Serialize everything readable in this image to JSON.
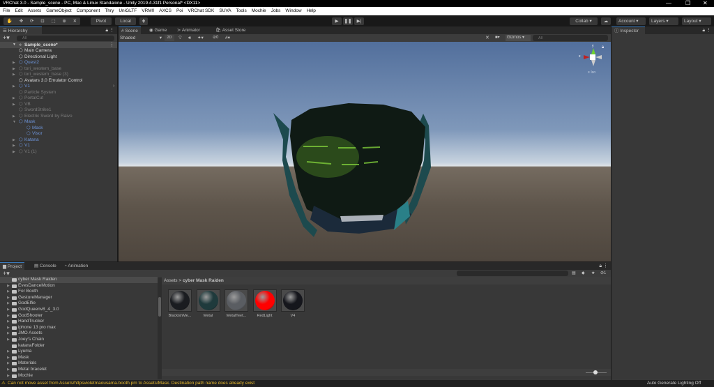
{
  "window": {
    "title": "VRChat 3.0 - Sample_scene - PC, Mac & Linux Standalone - Unity 2019.4.31f1 Personal* <DX11>",
    "minimize": "—",
    "restore": "❐",
    "close": "✕"
  },
  "menu": [
    "File",
    "Edit",
    "Assets",
    "GameObject",
    "Component",
    "Thry",
    "UniGLTF",
    "VRM0",
    "AXCS",
    "Poi",
    "VRChat SDK",
    "SUVA",
    "Tools",
    "Mochie",
    "Jobs",
    "Window",
    "Help"
  ],
  "toolbar": {
    "pivot": "Pivot",
    "local": "Local",
    "collab": "Collab ▾",
    "account": "Account",
    "layers": "Layers",
    "layout": "Layout",
    "play": "▶",
    "pause": "❚❚",
    "step": "▶|"
  },
  "hierarchy": {
    "tab": "Hierarchy",
    "search_placeholder": "All",
    "scene": "Sample_scene*",
    "items": [
      {
        "label": "Main Camera",
        "style": "white",
        "depth": 1,
        "arrow": false
      },
      {
        "label": "Directional Light",
        "style": "white",
        "depth": 1,
        "arrow": false
      },
      {
        "label": "Quest2",
        "style": "blue",
        "depth": 1,
        "arrow": true
      },
      {
        "label": "tori_western_base",
        "style": "dim",
        "depth": 1,
        "arrow": true
      },
      {
        "label": "tori_western_base (3)",
        "style": "dim",
        "depth": 1,
        "arrow": true
      },
      {
        "label": "Avatars 3.0 Emulator Control",
        "style": "white",
        "depth": 1,
        "arrow": false
      },
      {
        "label": "V1",
        "style": "blue",
        "depth": 1,
        "arrow": true
      },
      {
        "label": "Particle System",
        "style": "dim",
        "depth": 1,
        "arrow": false
      },
      {
        "label": "PortalCut",
        "style": "dim",
        "depth": 1,
        "arrow": true
      },
      {
        "label": "VB",
        "style": "dim",
        "depth": 1,
        "arrow": true
      },
      {
        "label": "SwordStrike1",
        "style": "dim",
        "depth": 1,
        "arrow": false
      },
      {
        "label": "Electric Sword by Raivo",
        "style": "dim",
        "depth": 1,
        "arrow": true
      },
      {
        "label": "Mask",
        "style": "blue",
        "depth": 1,
        "arrow": true,
        "open": true
      },
      {
        "label": "Mask",
        "style": "blue",
        "depth": 2,
        "arrow": false
      },
      {
        "label": "Visor",
        "style": "blue",
        "depth": 2,
        "arrow": false
      },
      {
        "label": "Katana",
        "style": "blue",
        "depth": 1,
        "arrow": true
      },
      {
        "label": "V1",
        "style": "blue",
        "depth": 1,
        "arrow": true
      },
      {
        "label": "V1 (1)",
        "style": "dim",
        "depth": 1,
        "arrow": true
      }
    ]
  },
  "scene": {
    "tabs": [
      "Scene",
      "Game",
      "Animator",
      "Asset Store"
    ],
    "shading": "Shaded",
    "mode2d": "2D",
    "hidden_count": "0",
    "gizmos": "Gizmos",
    "search_placeholder": "All",
    "gizmo_x": "x",
    "gizmo_y": "y",
    "projection": "Iso"
  },
  "inspector": {
    "tab": "Inspector"
  },
  "project": {
    "tabs": [
      "Project",
      "Console",
      "Animation"
    ],
    "hidden_count": "1",
    "folders": [
      {
        "label": "cyber Mask Raiden",
        "selected": true,
        "arrow": false
      },
      {
        "label": "EvesDanceMotion",
        "arrow": true
      },
      {
        "label": "For Booth",
        "arrow": true
      },
      {
        "label": "GestureManager",
        "arrow": true
      },
      {
        "label": "GodElfie",
        "arrow": true
      },
      {
        "label": "GodQueenv8_4_3.0",
        "arrow": true
      },
      {
        "label": "GodShooter",
        "arrow": true
      },
      {
        "label": "HandTrucker",
        "arrow": true
      },
      {
        "label": "iphone 13 pro max",
        "arrow": true
      },
      {
        "label": "JMO Assets",
        "arrow": true
      },
      {
        "label": "Joey's Chain",
        "arrow": true
      },
      {
        "label": "katanaFolder",
        "arrow": false
      },
      {
        "label": "Lyuma",
        "arrow": true
      },
      {
        "label": "Mask",
        "arrow": true
      },
      {
        "label": "Materials",
        "arrow": true
      },
      {
        "label": "Metal bracelet",
        "arrow": true
      },
      {
        "label": "Mochie",
        "arrow": true
      }
    ],
    "breadcrumb": {
      "root": "Assets",
      "sep": ">",
      "current": "cyber Mask Raiden"
    },
    "assets": [
      {
        "label": "BlackishMe...",
        "color": "#1a1c20"
      },
      {
        "label": "Metal",
        "color": "#1f3a3c"
      },
      {
        "label": "MetalTeet...",
        "color": "#5a5d62"
      },
      {
        "label": "RedLight",
        "color": "#ff0000"
      },
      {
        "label": "V4",
        "color": "#15161c"
      }
    ]
  },
  "status": {
    "warning": "Can not move asset from Assets/httpsvioletmaousama.booth.pm to Assets/Mask. Destination path name does already exist",
    "lighting": "Auto Generate Lighting Off"
  }
}
